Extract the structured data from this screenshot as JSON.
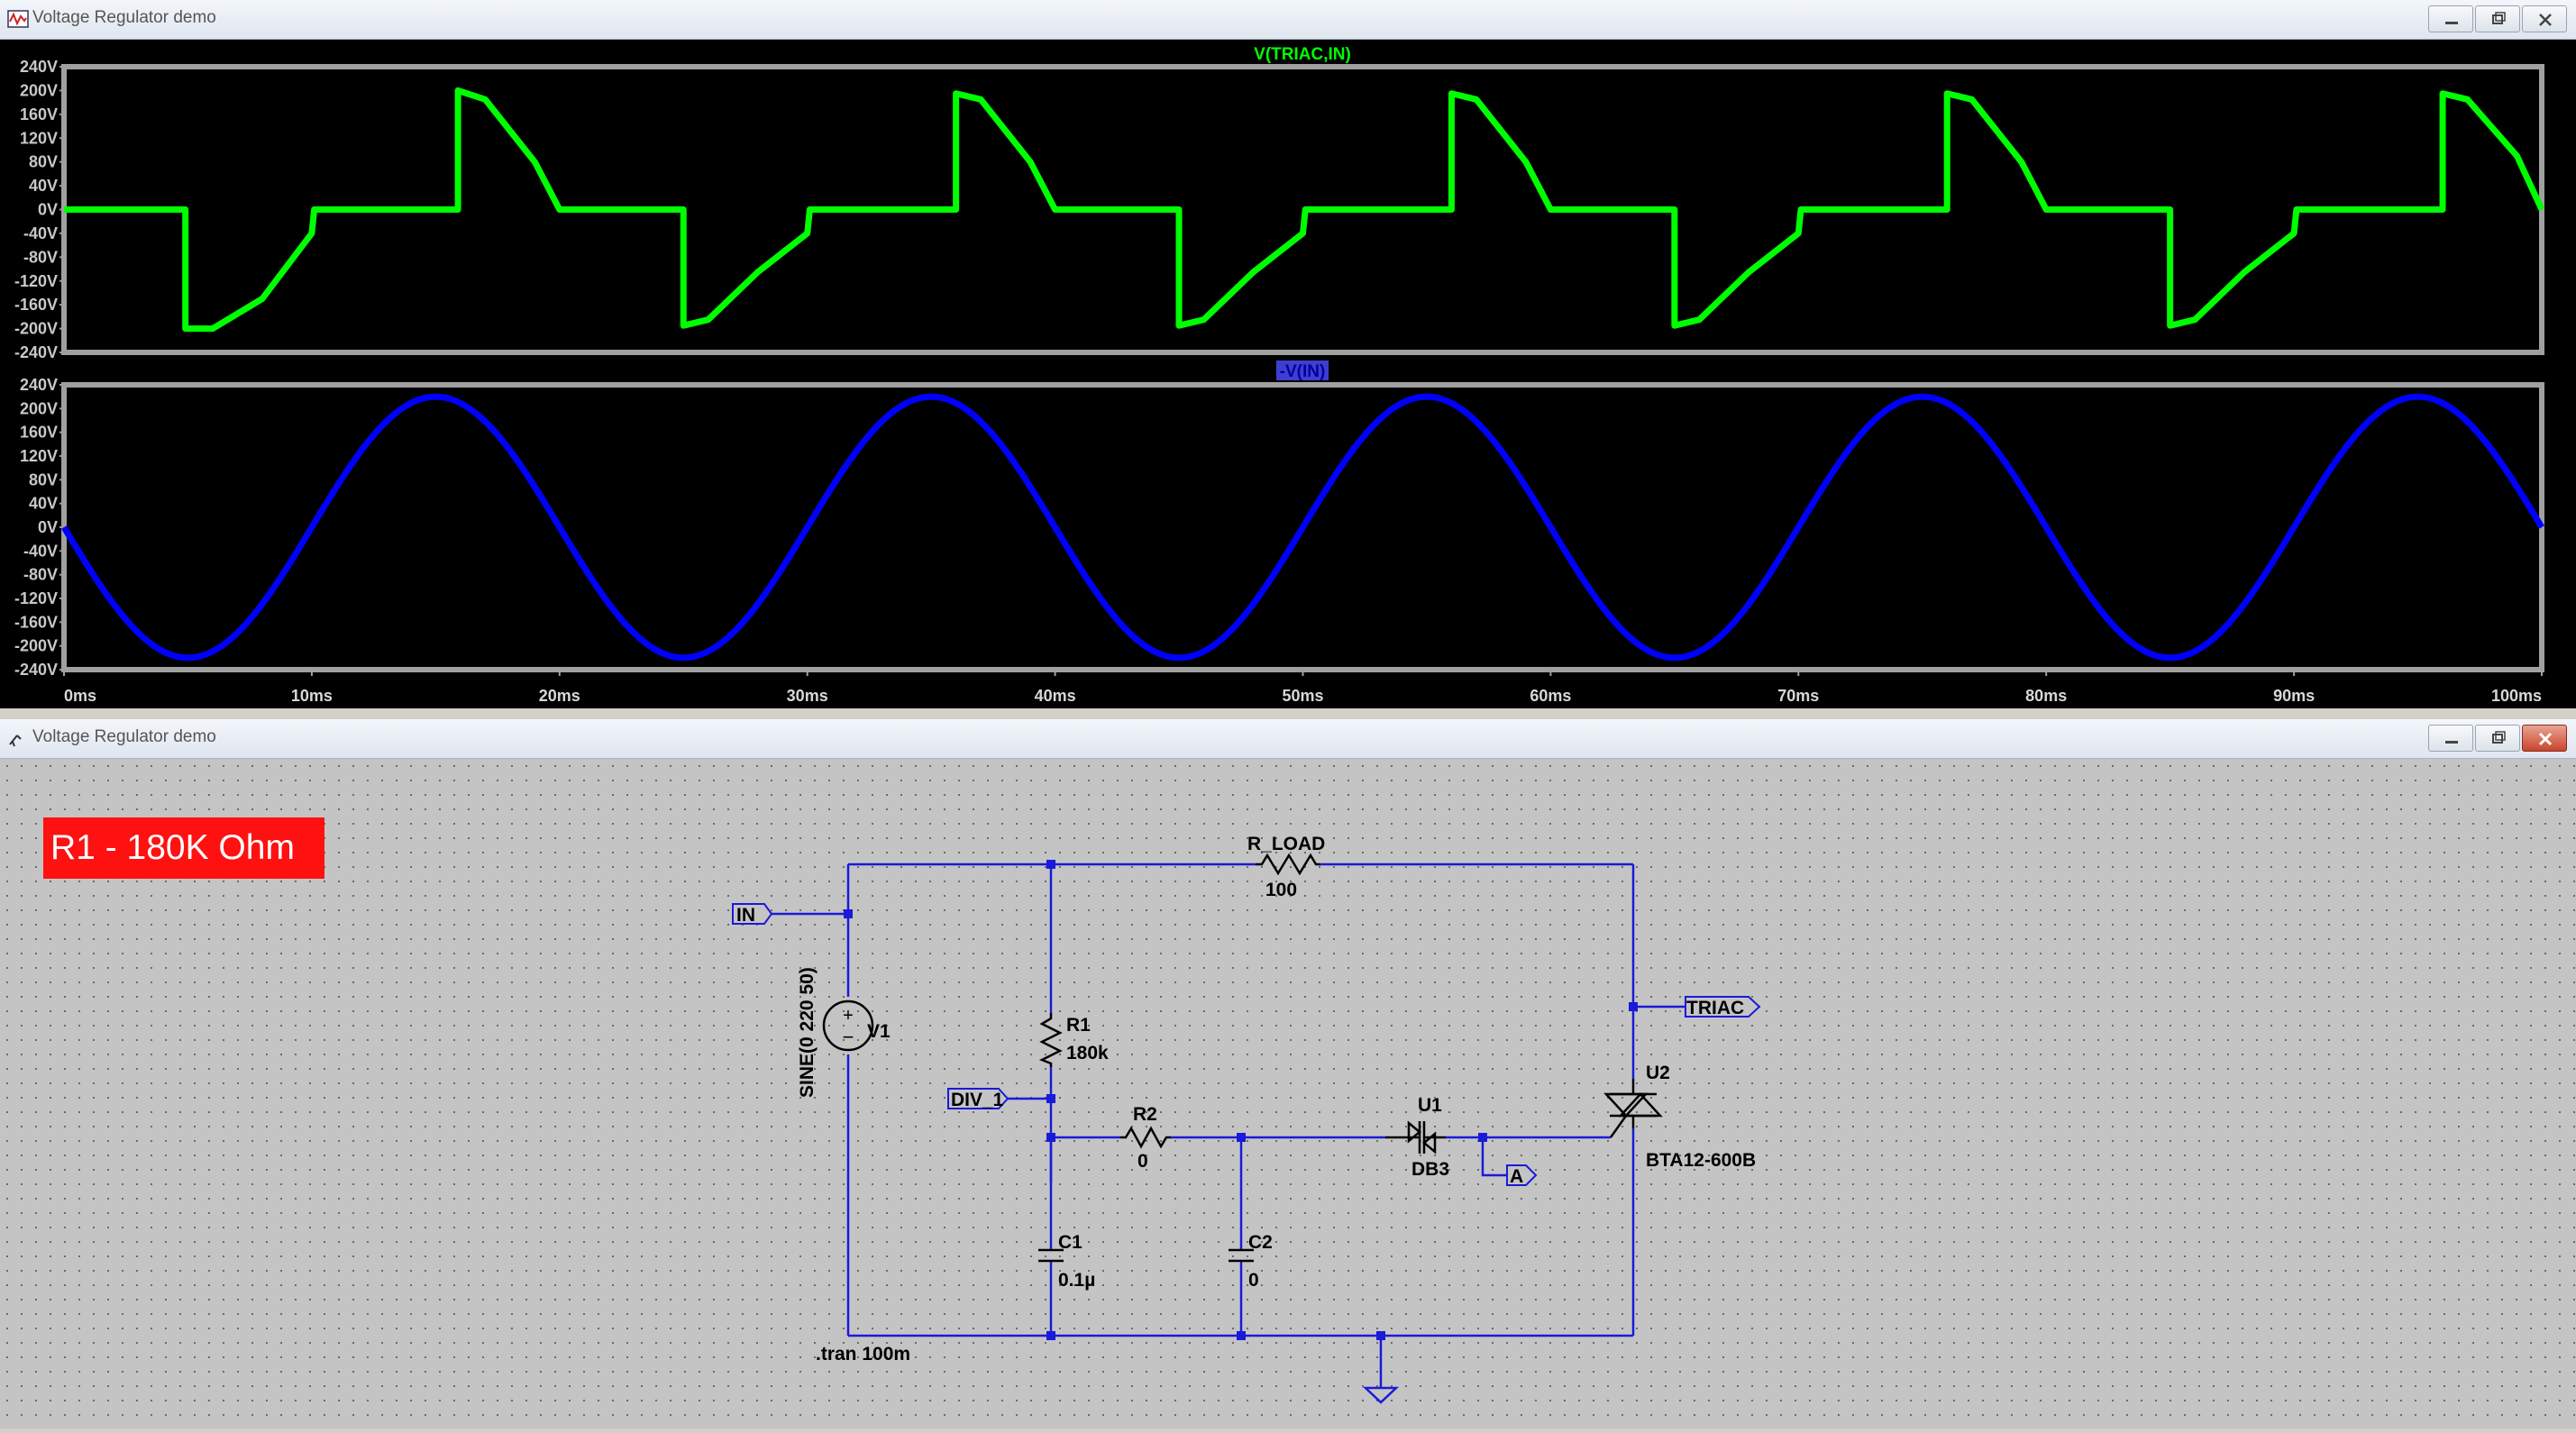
{
  "waveform_window": {
    "title": "Voltage Regulator demo",
    "top_trace_label": "V(TRIAC,IN)",
    "bottom_trace_label": "-V(IN)",
    "y_ticks": [
      "240V",
      "200V",
      "160V",
      "120V",
      "80V",
      "40V",
      "0V",
      "-40V",
      "-80V",
      "-120V",
      "-160V",
      "-200V",
      "-240V"
    ],
    "x_ticks": [
      "0ms",
      "10ms",
      "20ms",
      "30ms",
      "40ms",
      "50ms",
      "60ms",
      "70ms",
      "80ms",
      "90ms",
      "100ms"
    ],
    "colors": {
      "top_trace": "#00ff00",
      "bottom_trace": "#0000ff",
      "background": "#000000",
      "frame": "#a0a0a0"
    }
  },
  "chart_data": [
    {
      "type": "line",
      "title": "V(TRIAC,IN)",
      "xlabel": "",
      "ylabel": "",
      "xlim": [
        0,
        100
      ],
      "ylim": [
        -240,
        240
      ],
      "series": [
        {
          "name": "V(TRIAC,IN)",
          "x": [
            0,
            4.9,
            4.9,
            6,
            8,
            10,
            10.1,
            15.9,
            15.9,
            17,
            19,
            20,
            20.1,
            25,
            25,
            26,
            28,
            30,
            30.1,
            36,
            36,
            37,
            39,
            40,
            40.1,
            45,
            45,
            46,
            48,
            50,
            50.1,
            56,
            56,
            57,
            59,
            60,
            60.1,
            65,
            65,
            66,
            68,
            70,
            70.1,
            76,
            76,
            77,
            79,
            80,
            80.1,
            85,
            85,
            86,
            88,
            90,
            90.1,
            96,
            96,
            97,
            99,
            100
          ],
          "y": [
            0,
            0,
            -200,
            -200,
            -150,
            -40,
            0,
            0,
            200,
            185,
            80,
            0,
            0,
            0,
            -195,
            -185,
            -105,
            -40,
            0,
            0,
            195,
            185,
            80,
            0,
            0,
            0,
            -195,
            -185,
            -105,
            -40,
            0,
            0,
            195,
            185,
            80,
            0,
            0,
            0,
            -195,
            -185,
            -105,
            -40,
            0,
            0,
            195,
            185,
            80,
            0,
            0,
            0,
            -195,
            -185,
            -105,
            -40,
            0,
            0,
            195,
            185,
            90,
            0
          ]
        }
      ]
    },
    {
      "type": "line",
      "title": "-V(IN)",
      "xlabel": "",
      "ylabel": "",
      "xlim": [
        0,
        100
      ],
      "ylim": [
        -240,
        240
      ],
      "series": [
        {
          "name": "-V(IN)",
          "function": "-220*sin(2*pi*50*t)",
          "amplitude": 220,
          "frequency_hz": 50,
          "x_range": [
            0,
            100
          ]
        }
      ]
    }
  ],
  "schematic_window": {
    "title": "Voltage Regulator demo",
    "banner": "R1 - 180K Ohm",
    "labels": {
      "r_load_name": "R_LOAD",
      "r_load_value": "100",
      "r1_name": "R1",
      "r1_value": "180k",
      "r2_name": "R2",
      "r2_value": "0",
      "c1_name": "C1",
      "c1_value": "0.1µ",
      "c2_name": "C2",
      "c2_value": "0",
      "v1_name": "V1",
      "v1_value": "SINE(0 220 50)",
      "u1_name": "U1",
      "u1_value": "DB3",
      "u2_name": "U2",
      "u2_value": "BTA12-600B",
      "net_in": "IN",
      "net_triac": "TRIAC",
      "net_div": "DIV_1",
      "net_a": "A",
      "directive": ".tran 100m"
    },
    "colors": {
      "wire": "#1a1ad9",
      "background": "#c4c4c4",
      "banner": "#ff1111"
    }
  }
}
